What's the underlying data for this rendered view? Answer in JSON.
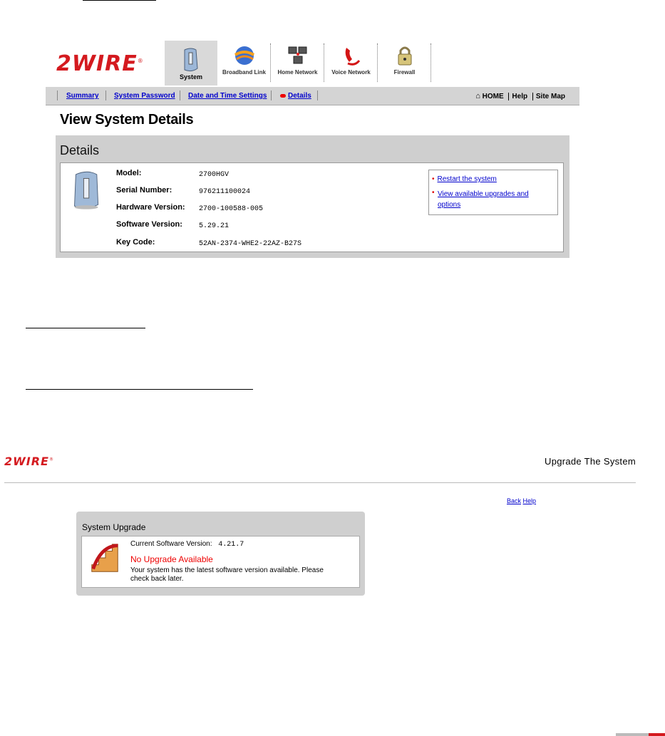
{
  "top_ui": {
    "logo_text": "2WIRE",
    "tabs": [
      {
        "label": "System",
        "icon": "system-icon",
        "active": true
      },
      {
        "label": "Broadband Link",
        "icon": "globe-icon",
        "active": false
      },
      {
        "label": "Home Network",
        "icon": "network-computers-icon",
        "active": false
      },
      {
        "label": "Voice Network",
        "icon": "phone-icon",
        "active": false
      },
      {
        "label": "Firewall",
        "icon": "lock-icon",
        "active": false
      }
    ],
    "subnav": {
      "items": [
        "Summary",
        "System Password",
        "Date and Time Settings",
        "Details"
      ],
      "active": "Details",
      "right": {
        "home": "HOME",
        "help": "Help",
        "sitemap": "Site Map"
      }
    },
    "page_title": "View System Details",
    "section_title": "Details",
    "rows": [
      {
        "label": "Model:",
        "value": "2700HGV"
      },
      {
        "label": "Serial Number:",
        "value": "976211100024"
      },
      {
        "label": "Hardware Version:",
        "value": "2700-100588-005"
      },
      {
        "label": "Software Version:",
        "value": "5.29.21"
      },
      {
        "label": "Key Code:",
        "value": "52AN-2374-WHE2-22AZ-B27S"
      }
    ],
    "actions": [
      "Restart the system",
      "View available upgrades and options"
    ]
  },
  "bottom_ui": {
    "logo_text": "2WIRE",
    "title": "Upgrade The System",
    "links": {
      "back": "Back",
      "help": "Help"
    },
    "section_title": "System Upgrade",
    "current_version_label": "Current Software Version:",
    "current_version_value": "4.21.7",
    "status": "No Upgrade Available",
    "message": "Your system has the latest software version available. Please check back later."
  },
  "colors": {
    "brand_red": "#d41a1f",
    "link_blue": "#0000cc",
    "panel_gray": "#cfcfcf"
  }
}
